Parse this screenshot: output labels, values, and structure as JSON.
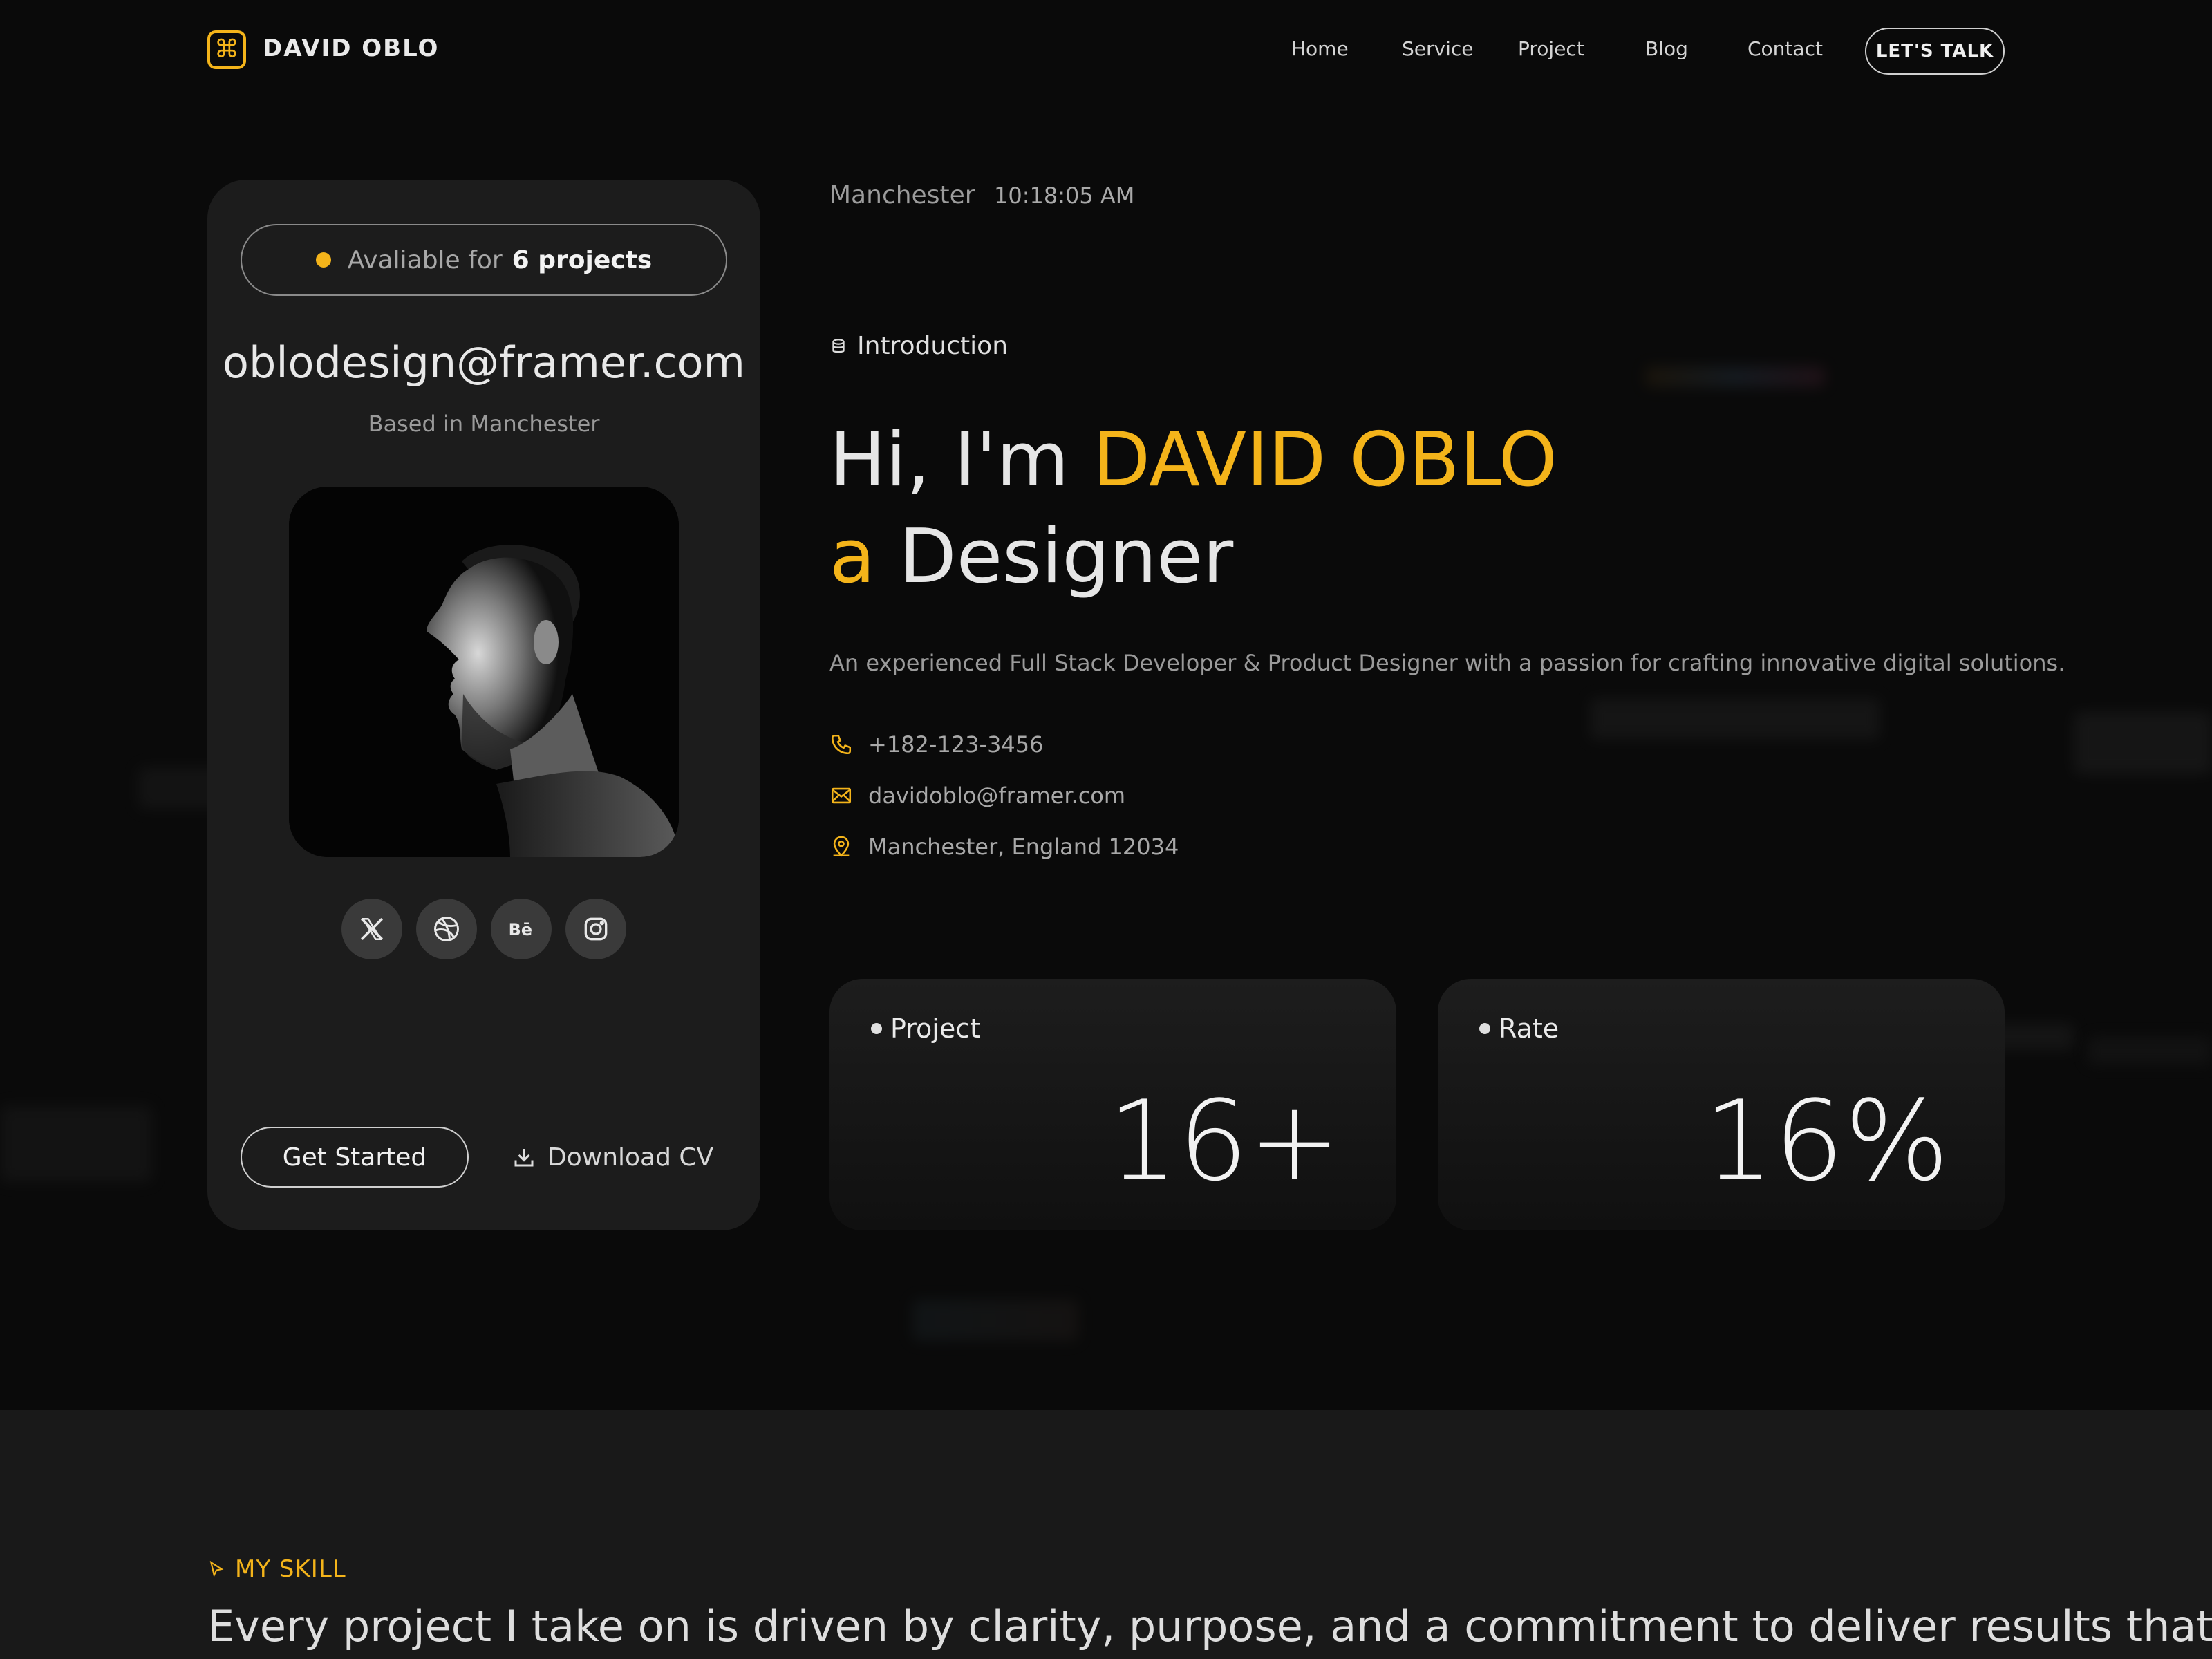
{
  "brand": {
    "name": "DAVID OBLO",
    "logo_icon": "command-icon",
    "accent": "#f4b41a"
  },
  "nav": {
    "links": [
      "Home",
      "Service",
      "Project",
      "Blog",
      "Contact"
    ],
    "cta": "LET'S TALK"
  },
  "profile_card": {
    "availability_prefix": "Avaliable for",
    "availability_count": "6 projects",
    "email": "oblodesign@framer.com",
    "based": "Based in Manchester",
    "socials": [
      "x-icon",
      "dribbble-icon",
      "behance-icon",
      "instagram-icon"
    ],
    "get_started": "Get Started",
    "download_cv": "Download CV"
  },
  "hero": {
    "city": "Manchester",
    "time": "10:18:05 AM",
    "intro_label": "Introduction",
    "greeting": "Hi, I'm",
    "name": "DAVID OBLO",
    "article": "a",
    "role": "Designer",
    "description": "An experienced Full Stack Developer & Product Designer with a passion for crafting innovative digital solutions.",
    "phone": "+182-123-3456",
    "email": "davidoblo@framer.com",
    "address": "Manchester, England 12034"
  },
  "stats": [
    {
      "label": "Project",
      "value": "16+"
    },
    {
      "label": "Rate",
      "value": "16%"
    }
  ],
  "skills": {
    "tag": "MY SKILL",
    "headline": "Every project I take on is driven by clarity, purpose, and a commitment to deliver results that"
  }
}
